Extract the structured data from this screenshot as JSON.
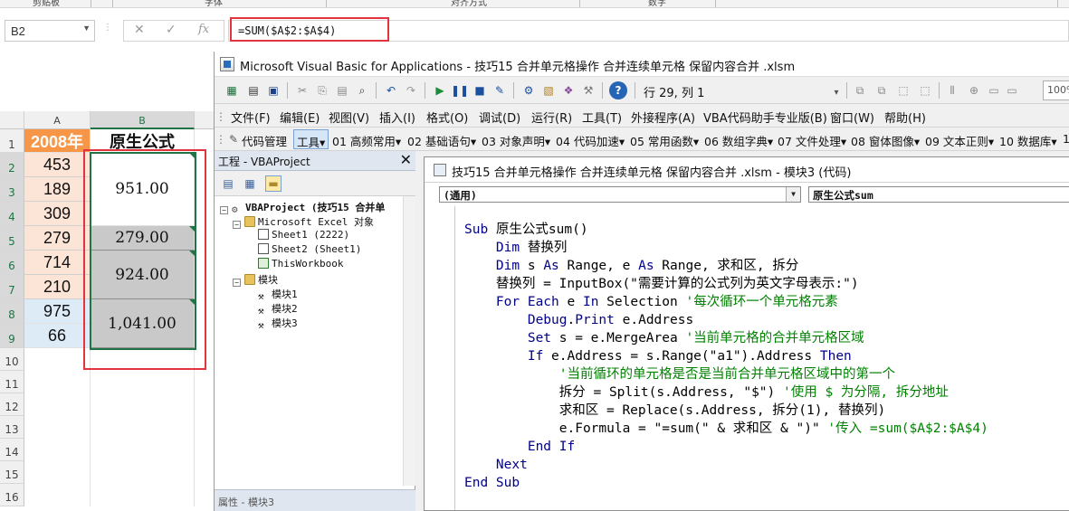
{
  "ribbon_labels": [
    "剪贴板",
    "字体",
    "对齐方式",
    "数字"
  ],
  "excel": {
    "name_box": "B2",
    "formula": "=SUM($A$2:$A$4)",
    "columns": [
      "A",
      "B"
    ],
    "rows": [
      "1",
      "2",
      "3",
      "4",
      "5",
      "6",
      "7",
      "8",
      "9",
      "10",
      "11",
      "12",
      "13",
      "14",
      "15",
      "16"
    ],
    "a_header": "2008年",
    "b_header": "原生公式",
    "a_values": [
      "453",
      "189",
      "309",
      "279",
      "714",
      "210",
      "975",
      "66"
    ],
    "b_merged": [
      "951.00",
      "279.00",
      "924.00",
      "1,041.00"
    ]
  },
  "vbe": {
    "title": "Microsoft Visual Basic for Applications - 技巧15  合并单元格操作  合并连续单元格  保留内容合并  .xlsm",
    "position": "行 29, 列 1",
    "zoom": "100%",
    "menu": [
      "文件(F)",
      "编辑(E)",
      "视图(V)",
      "插入(I)",
      "格式(O)",
      "调试(D)",
      "运行(R)",
      "工具(T)",
      "外接程序(A)",
      "VBA代码助手专业版(B)",
      "窗口(W)",
      "帮助(H)"
    ],
    "addin_toolbar": [
      "代码管理",
      "工具▾",
      "01 高频常用▾",
      "02 基础语句▾",
      "03 对象声明▾",
      "04 代码加速▾",
      "05 常用函数▾",
      "06 数组字典▾",
      "07 文件处理▾",
      "08 窗体图像▾",
      "09 文本正则▾",
      "10 数据库▾",
      "1"
    ],
    "project": {
      "header": "工程 - VBAProject",
      "tree": [
        "VBAProject (技巧15  合并单",
        "Microsoft Excel 对象",
        "Sheet1 (2222)",
        "Sheet2 (Sheet1)",
        "ThisWorkbook",
        "模块",
        "模块1",
        "模块2",
        "模块3"
      ],
      "bottom": "属性 - 模块3"
    },
    "code_window": {
      "title": "技巧15  合并单元格操作  合并连续单元格  保留内容合并  .xlsm - 模块3 (代码)",
      "object_combo": "(通用)",
      "proc_combo": "原生公式sum"
    },
    "code_lines": [
      [
        {
          "t": "Sub ",
          "c": "kw"
        },
        {
          "t": "原生公式sum()"
        }
      ],
      [
        {
          "t": "    "
        },
        {
          "t": "Dim ",
          "c": "kw"
        },
        {
          "t": "替换列"
        }
      ],
      [
        {
          "t": "    "
        },
        {
          "t": "Dim ",
          "c": "kw"
        },
        {
          "t": "s "
        },
        {
          "t": "As ",
          "c": "kw"
        },
        {
          "t": "Range, e "
        },
        {
          "t": "As ",
          "c": "kw"
        },
        {
          "t": "Range, 求和区, 拆分"
        }
      ],
      [
        {
          "t": "    替换列 = InputBox(\"需要计算的公式列为英文字母表示:\")"
        }
      ],
      [
        {
          "t": "    "
        },
        {
          "t": "For Each ",
          "c": "kw"
        },
        {
          "t": "e "
        },
        {
          "t": "In ",
          "c": "kw"
        },
        {
          "t": "Selection "
        },
        {
          "t": "'每次循环一个单元格元素",
          "c": "cm"
        }
      ],
      [
        {
          "t": "        "
        },
        {
          "t": "Debug",
          "c": "kw"
        },
        {
          "t": "."
        },
        {
          "t": "Print ",
          "c": "kw"
        },
        {
          "t": "e.Address"
        }
      ],
      [
        {
          "t": "        "
        },
        {
          "t": "Set ",
          "c": "kw"
        },
        {
          "t": "s = e.MergeArea "
        },
        {
          "t": "'当前单元格的合并单元格区域",
          "c": "cm"
        }
      ],
      [
        {
          "t": "        "
        },
        {
          "t": "If ",
          "c": "kw"
        },
        {
          "t": "e.Address = s.Range(\"a1\").Address "
        },
        {
          "t": "Then",
          "c": "kw"
        }
      ],
      [
        {
          "t": "            "
        },
        {
          "t": "'当前循环的单元格是否是当前合并单元格区域中的第一个",
          "c": "cm"
        }
      ],
      [
        {
          "t": "            拆分 = Split(s.Address, \"$\") "
        },
        {
          "t": "'使用 $ 为分隔, 拆分地址",
          "c": "cm"
        }
      ],
      [
        {
          "t": "            求和区 = Replace(s.Address, 拆分(1), 替换列)"
        }
      ],
      [
        {
          "t": "            e.Formula = \"=sum(\" & 求和区 & \")\" "
        },
        {
          "t": "'传入 =sum($A$2:$A$4)",
          "c": "cm"
        }
      ],
      [
        {
          "t": "        "
        },
        {
          "t": "End If",
          "c": "kw"
        }
      ],
      [
        {
          "t": "    "
        },
        {
          "t": "Next",
          "c": "kw"
        }
      ],
      [
        {
          "t": "End Sub",
          "c": "kw"
        }
      ]
    ]
  }
}
